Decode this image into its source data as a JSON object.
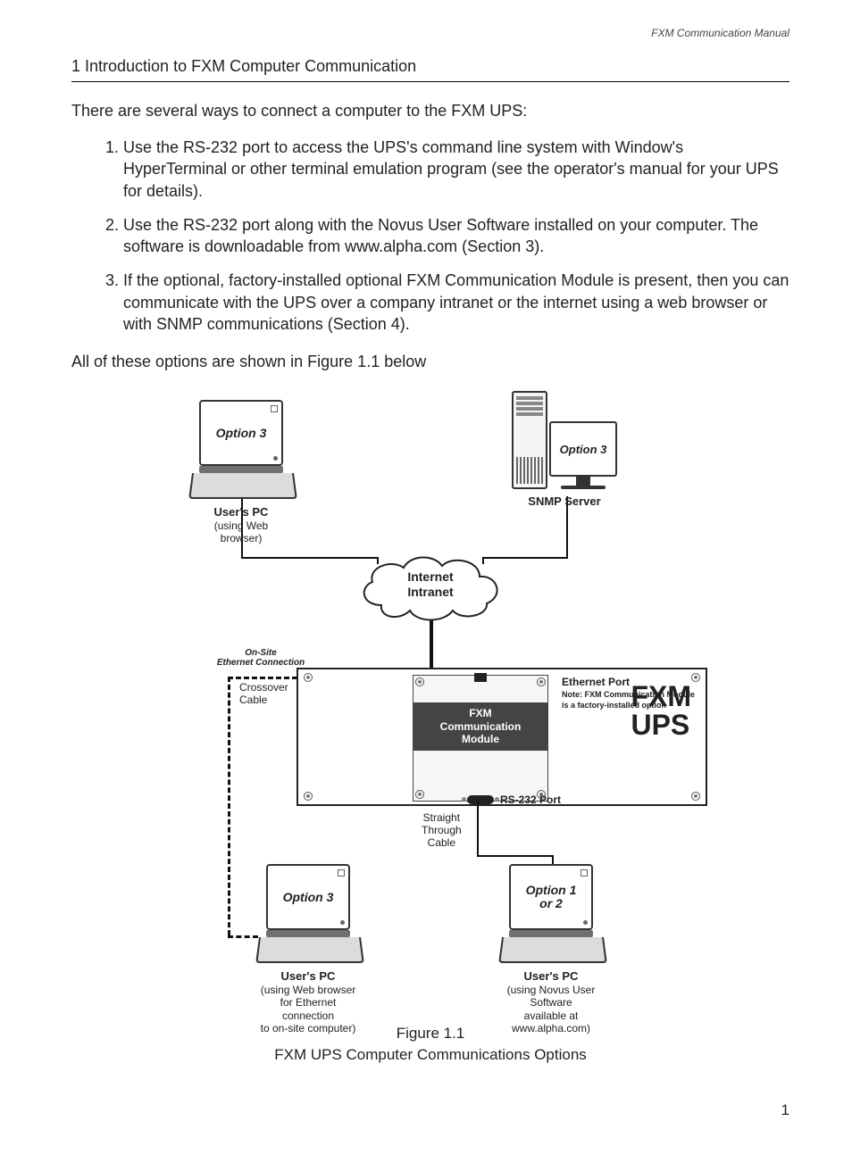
{
  "doc_header": "FXM Communication Manual",
  "section_title": "1 Introduction to FXM Computer Communication",
  "intro_text": "There are several ways to connect a computer to the FXM UPS:",
  "list_items": [
    "Use the RS-232 port to access the UPS's command line system with Window's HyperTerminal or other terminal emulation program (see the operator's manual for your UPS for details).",
    "Use the RS-232 port along with the Novus User Software installed on your computer. The software is downloadable from www.alpha.com (Section 3).",
    "If the optional, factory-installed optional FXM Communication Module is present, then you can communicate with the UPS over a company intranet or the internet using a web browser or with SNMP communications (Section 4)."
  ],
  "closing_text": "All of these options are shown in Figure 1.1 below",
  "figure": {
    "laptop_top_left": {
      "screen": "Option 3",
      "title": "User's PC",
      "sub": "(using Web browser)"
    },
    "server": {
      "screen": "Option 3",
      "title": "SNMP Server"
    },
    "cloud_line1": "Internet",
    "cloud_line2": "Intranet",
    "on_site": "On-Site\nEthernet Connection",
    "crossover": "Crossover\nCable",
    "comm_module": "FXM\nCommunication\nModule",
    "eth_label_title": "Ethernet Port",
    "eth_label_note": "Note: FXM Communication Module\nis a factory-installed option",
    "rs232_label": "RS-232 Port",
    "ups_title": "FXM\nUPS",
    "straight_cable": "Straight\nThrough\nCable",
    "laptop_bottom_left": {
      "screen": "Option 3",
      "title": "User's PC",
      "sub": "(using Web browser\nfor Ethernet connection\nto on-site computer)"
    },
    "laptop_bottom_right": {
      "screen": "Option 1\nor 2",
      "title": "User's PC",
      "sub": "(using Novus User Software\navailable at www.alpha.com)"
    },
    "caption_line1": "Figure 1.1",
    "caption_line2": "FXM UPS Computer Communications Options"
  },
  "page_number": "1"
}
